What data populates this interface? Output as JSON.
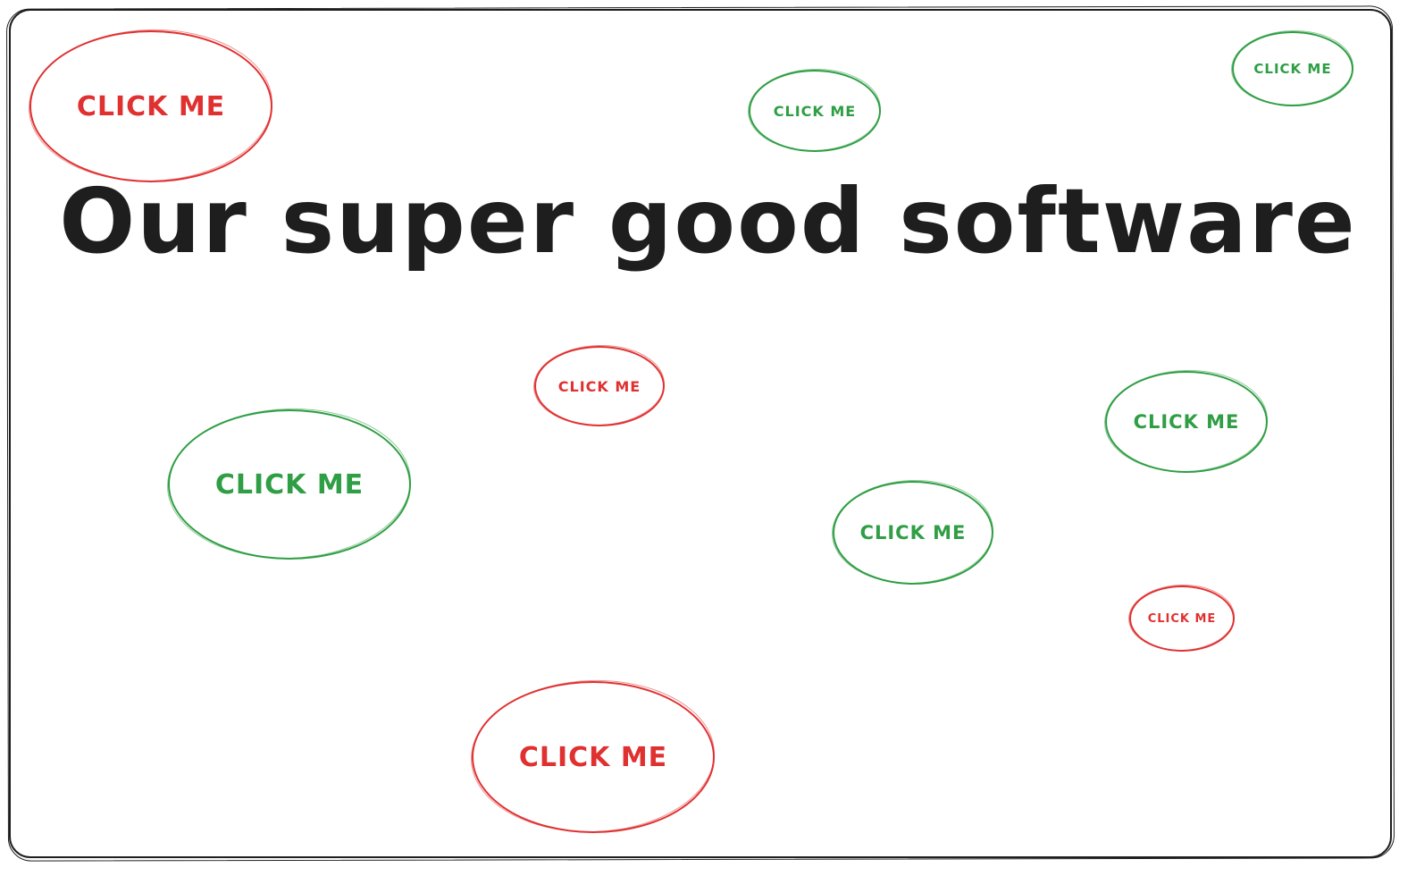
{
  "page": {
    "title": "Our super good software"
  },
  "buttons": [
    {
      "label": "CLICK ME",
      "color": "#e03131"
    },
    {
      "label": "CLICK ME",
      "color": "#2f9e44"
    },
    {
      "label": "CLICK ME",
      "color": "#2f9e44"
    },
    {
      "label": "CLICK ME",
      "color": "#e03131"
    },
    {
      "label": "CLICK ME",
      "color": "#2f9e44"
    },
    {
      "label": "CLICK ME",
      "color": "#2f9e44"
    },
    {
      "label": "CLICK ME",
      "color": "#2f9e44"
    },
    {
      "label": "CLICK ME",
      "color": "#e03131"
    },
    {
      "label": "CLICK ME",
      "color": "#e03131"
    }
  ],
  "colors": {
    "ink": "#1e1e1e",
    "red": "#e03131",
    "green": "#2f9e44",
    "background": "#ffffff"
  }
}
